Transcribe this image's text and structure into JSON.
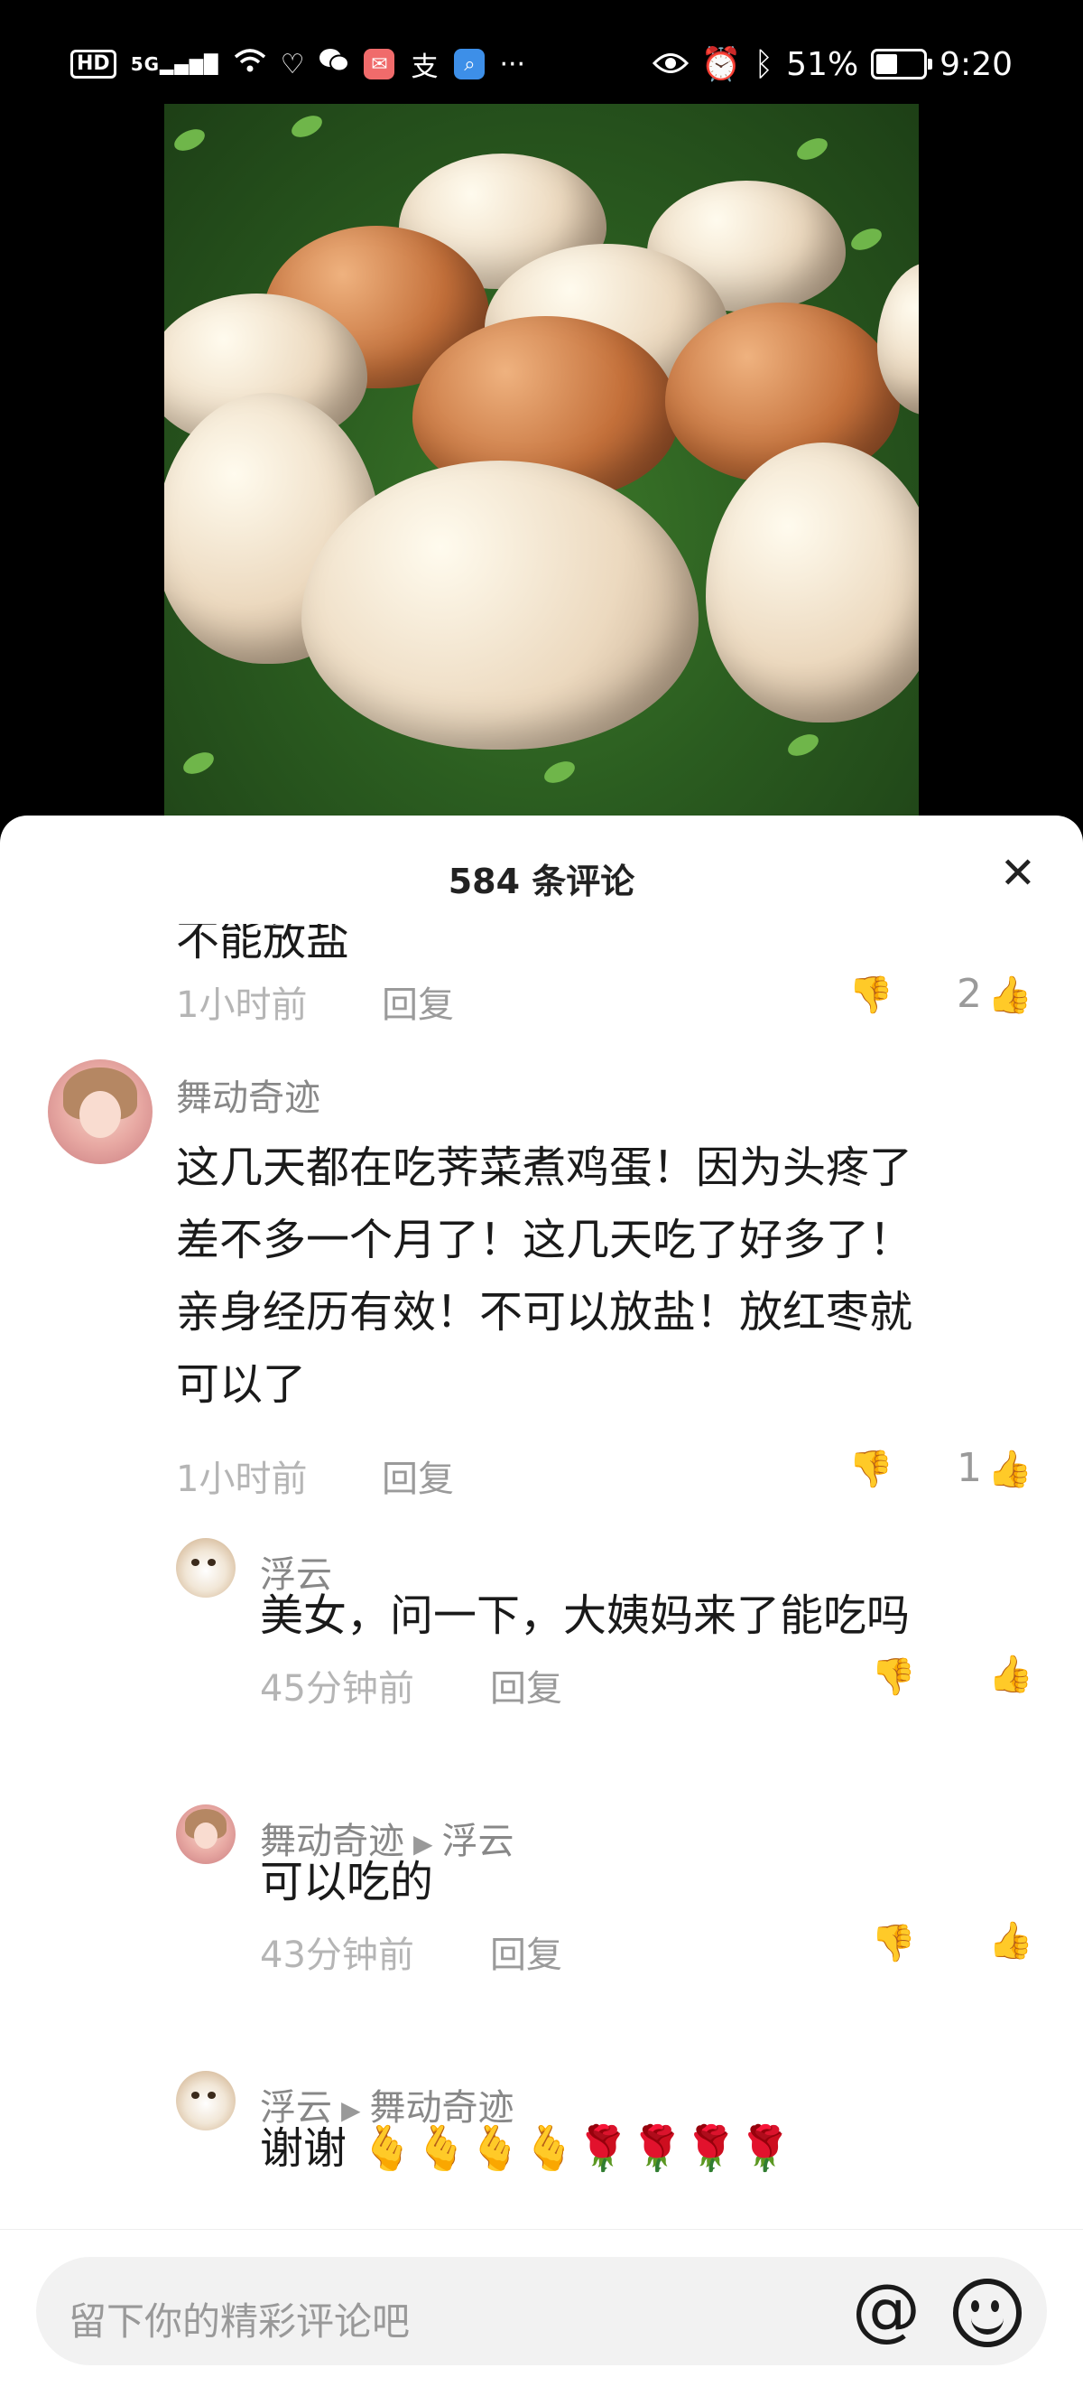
{
  "status_bar": {
    "hd": "HD",
    "network": "5G",
    "battery": "51%",
    "battery_level": 0.51,
    "time": "9:20",
    "alipay_glyph": "支",
    "more": "···"
  },
  "sheet": {
    "title": "584 条评论",
    "close_label": "✕"
  },
  "comments": [
    {
      "text": "不能放盐",
      "time": "1小时前",
      "reply_label": "回复",
      "likes": "2"
    },
    {
      "user": "舞动奇迹",
      "text_lines": [
        "这几天都在吃荠菜煮鸡蛋！因为头疼了",
        "差不多一个月了！这几天吃了好多了！",
        "亲身经历有效！不可以放盐！放红枣就",
        "可以了"
      ],
      "time": "1小时前",
      "reply_label": "回复",
      "likes": "1"
    }
  ],
  "replies": [
    {
      "user": "浮云",
      "text": "美女，问一下，大姨妈来了能吃吗",
      "time": "45分钟前",
      "reply_label": "回复"
    },
    {
      "user": "舞动奇迹",
      "reply_to": "浮云",
      "text": "可以吃的",
      "time": "43分钟前",
      "reply_label": "回复"
    },
    {
      "user": "浮云",
      "reply_to": "舞动奇迹",
      "text": "谢谢 🫰🫰🫰🫰🌹🌹🌹🌹",
      "time": "",
      "reply_label": ""
    }
  ],
  "input": {
    "placeholder": "留下你的精彩评论吧",
    "at_symbol": "@"
  }
}
